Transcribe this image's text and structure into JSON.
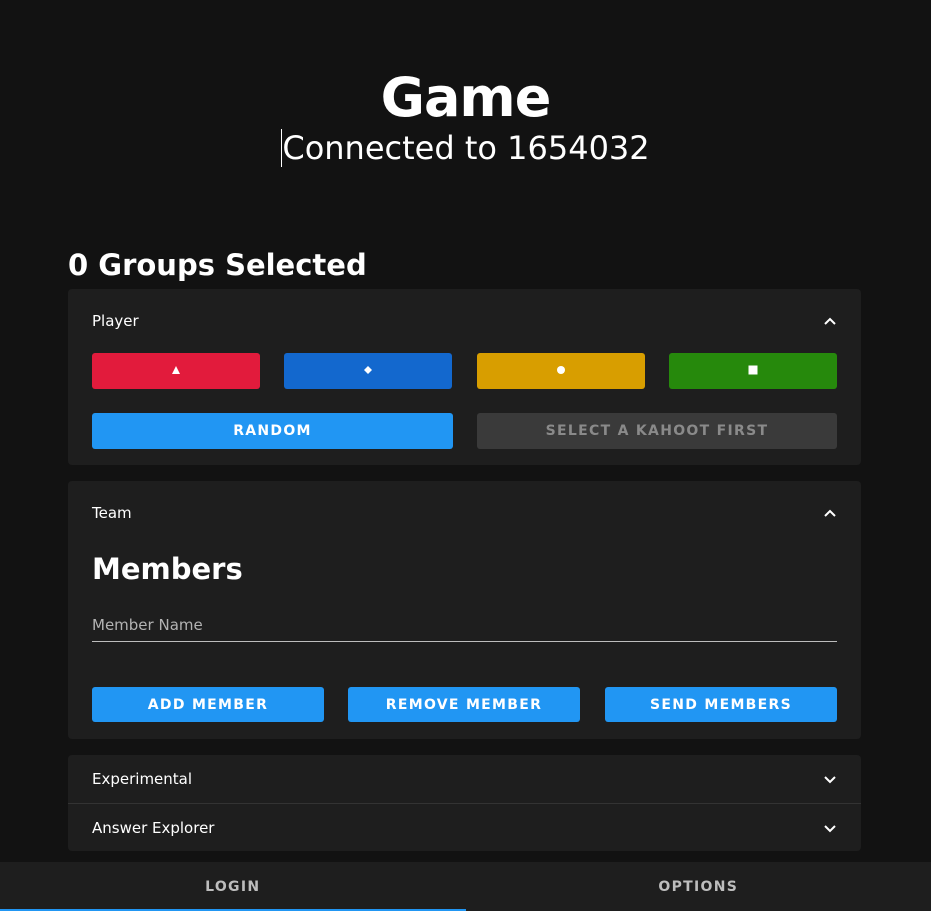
{
  "header": {
    "title": "Game",
    "subtitle": "Connected to 1654032"
  },
  "groups": {
    "title": "0 Groups Selected"
  },
  "player_panel": {
    "label": "Player",
    "expanded": true,
    "answer_buttons": [
      {
        "icon": "triangle-icon",
        "color": "#e21b3c"
      },
      {
        "icon": "diamond-icon",
        "color": "#1368ce"
      },
      {
        "icon": "circle-icon",
        "color": "#d89e00"
      },
      {
        "icon": "square-icon",
        "color": "#26890c"
      }
    ],
    "random_label": "RANDOM",
    "select_kahoot_label": "SELECT A KAHOOT FIRST"
  },
  "team_panel": {
    "label": "Team",
    "expanded": true,
    "members_title": "Members",
    "member_name_placeholder": "Member Name",
    "member_name_value": "",
    "add_label": "ADD MEMBER",
    "remove_label": "REMOVE MEMBER",
    "send_label": "SEND MEMBERS"
  },
  "experimental_panel": {
    "label": "Experimental",
    "expanded": false
  },
  "answer_explorer_panel": {
    "label": "Answer Explorer",
    "expanded": false
  },
  "bottom_nav": {
    "tabs": [
      {
        "label": "LOGIN",
        "active": true
      },
      {
        "label": "OPTIONS",
        "active": false
      }
    ]
  },
  "colors": {
    "accent": "#2196f3",
    "background": "#121212",
    "panel": "#1e1e1e"
  }
}
